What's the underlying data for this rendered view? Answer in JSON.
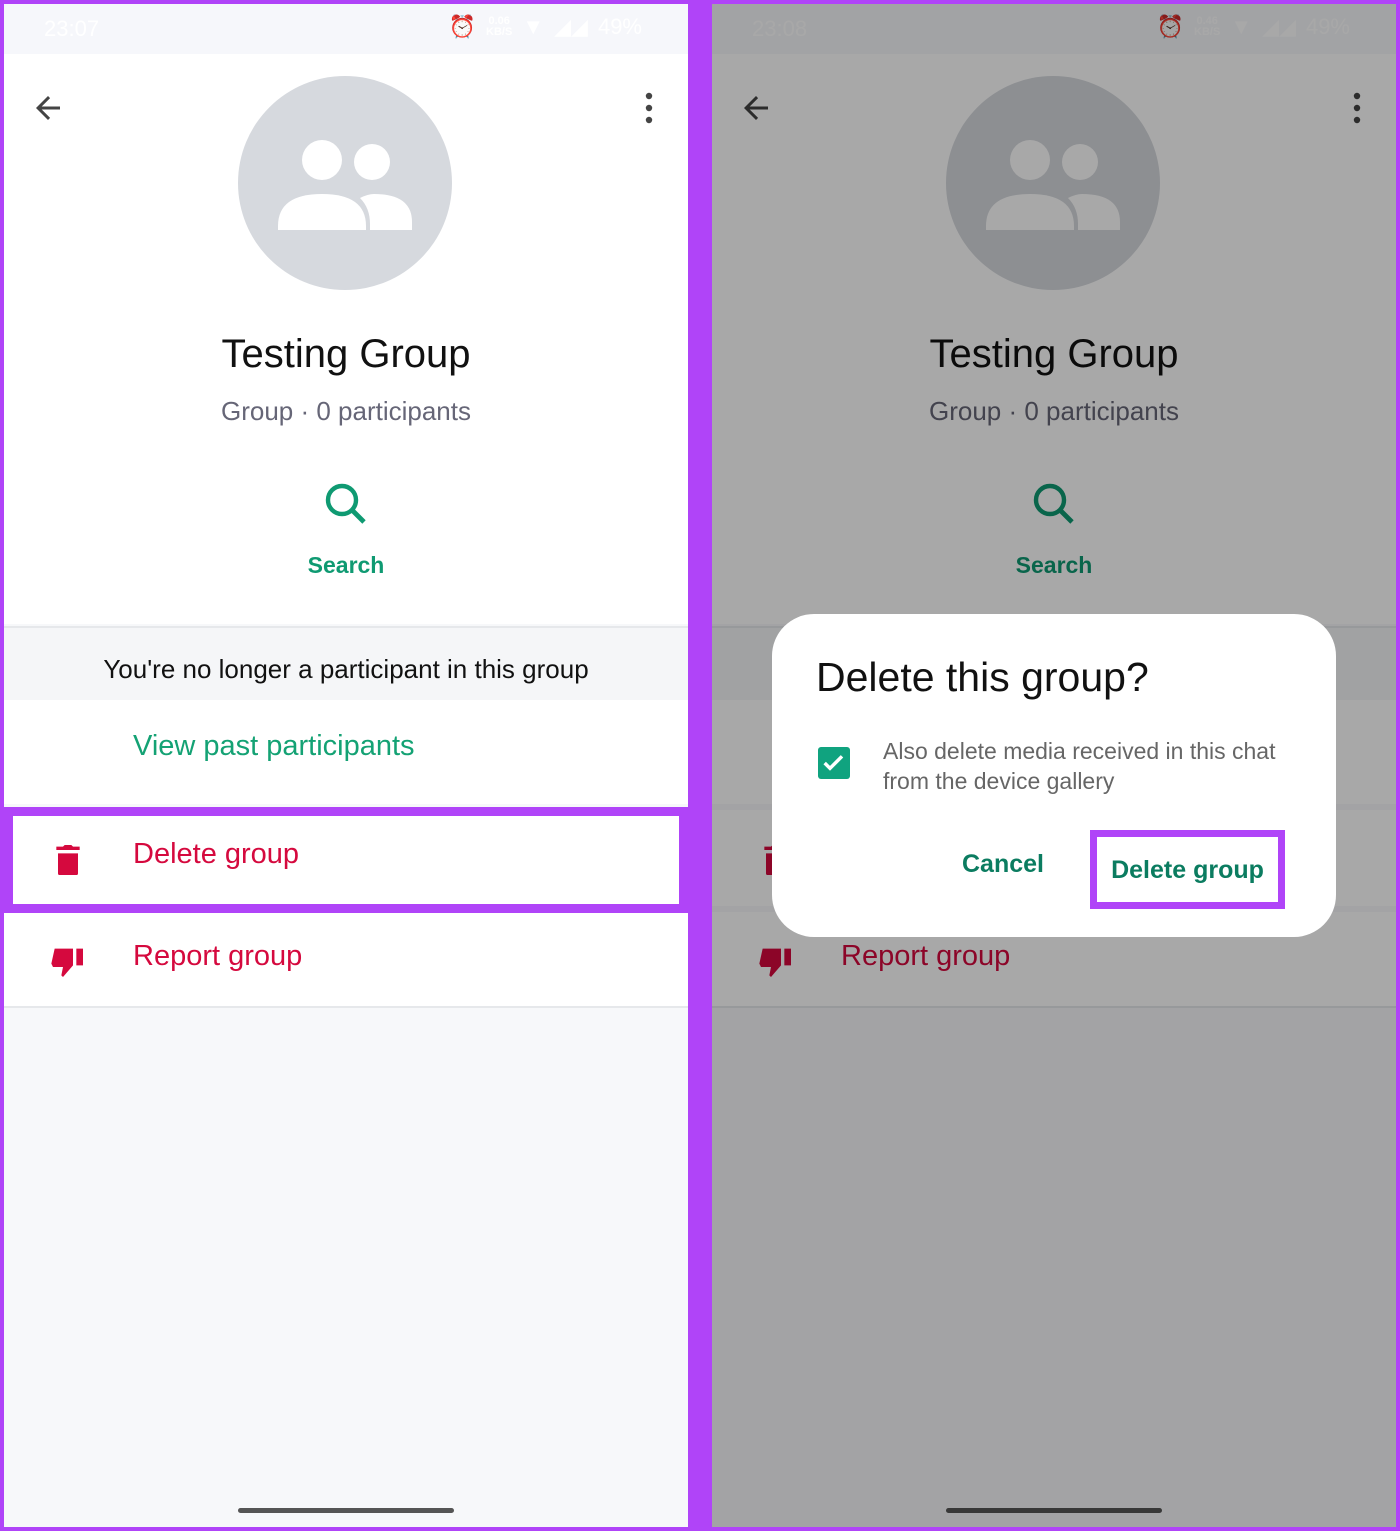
{
  "colors": {
    "accent": "#0f9a72",
    "danger": "#d5093e",
    "highlight": "#b044f8"
  },
  "left": {
    "status": {
      "time": "23:07",
      "speed": "0.06",
      "speed_unit": "KB/S",
      "battery": "49%"
    }
  },
  "right": {
    "status": {
      "time": "23:08",
      "speed": "0.46",
      "speed_unit": "KB/S",
      "battery": "49%"
    }
  },
  "group": {
    "name": "Testing Group",
    "subtitle": "Group · 0 participants",
    "search_label": "Search"
  },
  "notice": "You're no longer a participant in this group",
  "view_past": "View past participants",
  "actions": {
    "delete": "Delete group",
    "report": "Report group"
  },
  "dialog": {
    "title": "Delete this group?",
    "checkbox_label": "Also delete media received in this chat from the device gallery",
    "checkbox_checked": true,
    "cancel": "Cancel",
    "confirm": "Delete group"
  }
}
